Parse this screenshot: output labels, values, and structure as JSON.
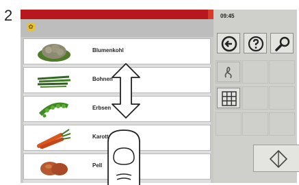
{
  "step_number": "2",
  "status": {
    "time": "09:45"
  },
  "list": {
    "items": [
      {
        "label": "Blumenkohl",
        "icon": "cauliflower-image"
      },
      {
        "label": "Bohnen",
        "icon": "green-beans-image"
      },
      {
        "label": "Erbsen",
        "icon": "peas-image"
      },
      {
        "label": "Karotten",
        "icon": "carrots-image"
      },
      {
        "label": "Pell",
        "icon": "potatoes-image"
      }
    ]
  },
  "toolbar": {
    "buttons": [
      {
        "name": "back-button",
        "icon": "arrow-left-circle-icon"
      },
      {
        "name": "help-button",
        "icon": "question-circle-icon"
      },
      {
        "name": "search-button",
        "icon": "magnifier-icon"
      },
      {
        "name": "handwriting-button",
        "icon": "pen-scribble-icon"
      },
      {
        "name": "keypad-button",
        "icon": "grid-keypad-icon"
      }
    ]
  },
  "overlay": {
    "gesture": "swipe-up-down",
    "icons": [
      "up-down-arrow-icon",
      "finger-icon"
    ]
  }
}
